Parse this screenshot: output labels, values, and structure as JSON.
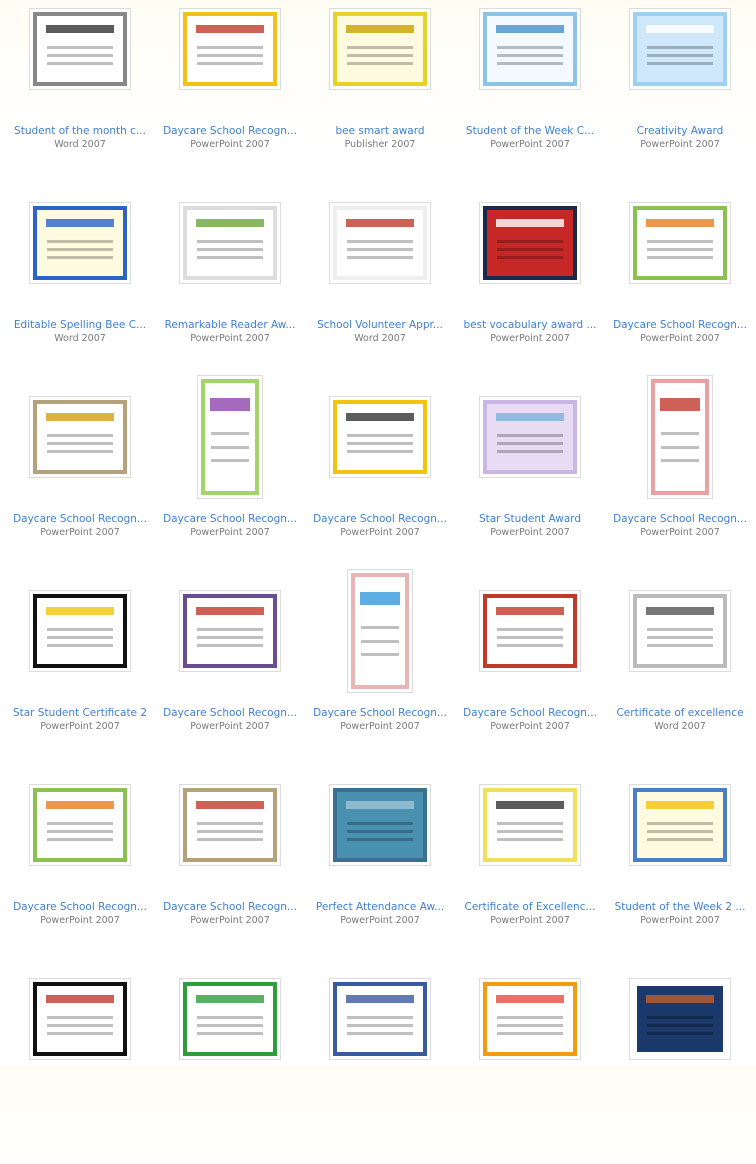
{
  "templates": [
    {
      "title": "Student of the month c...",
      "app": "Word 2007",
      "border": "#888888",
      "fill": "#ffffff",
      "accent": "#333333"
    },
    {
      "title": "Daycare School Recogn...",
      "app": "PowerPoint 2007",
      "border": "#f2c21b",
      "fill": "#ffffff",
      "accent": "#c0392b"
    },
    {
      "title": "bee smart award",
      "app": "Publisher 2007",
      "border": "#e6d22a",
      "fill": "#fffbe0",
      "accent": "#c9a200"
    },
    {
      "title": "Student of the Week C...",
      "app": "PowerPoint 2007",
      "border": "#8fc3e6",
      "fill": "#f2f9ff",
      "accent": "#4a90c8"
    },
    {
      "title": "Creativity Award",
      "app": "PowerPoint 2007",
      "border": "#9fd0f0",
      "fill": "#cfe8fb",
      "accent": "#ffffff"
    },
    {
      "title": "Editable Spelling Bee C...",
      "app": "Word 2007",
      "border": "#2b63c9",
      "fill": "#fffbe0",
      "accent": "#2b63c9"
    },
    {
      "title": "Remarkable Reader Aw...",
      "app": "PowerPoint 2007",
      "border": "#dddddd",
      "fill": "#ffffff",
      "accent": "#6aa83a"
    },
    {
      "title": "School Volunteer Appr...",
      "app": "Word 2007",
      "border": "#eeeeee",
      "fill": "#ffffff",
      "accent": "#c0392b"
    },
    {
      "title": "best vocabulary award ...",
      "app": "PowerPoint 2007",
      "border": "#1b2a4a",
      "fill": "#c62828",
      "accent": "#ffffff"
    },
    {
      "title": "Daycare School Recogn...",
      "app": "PowerPoint 2007",
      "border": "#8cc152",
      "fill": "#ffffff",
      "accent": "#e67e22"
    },
    {
      "title": "Daycare School Recogn...",
      "app": "PowerPoint 2007",
      "border": "#b5a27a",
      "fill": "#ffffff",
      "accent": "#d4a017"
    },
    {
      "title": "Daycare School Recogn...",
      "app": "PowerPoint 2007",
      "border": "#a5d46a",
      "fill": "#ffffff",
      "accent": "#8e44ad"
    },
    {
      "title": "Daycare School Recogn...",
      "app": "PowerPoint 2007",
      "border": "#f1c40f",
      "fill": "#ffffff",
      "accent": "#333333"
    },
    {
      "title": "Star Student Award",
      "app": "PowerPoint 2007",
      "border": "#c9b6e4",
      "fill": "#e8dcf5",
      "accent": "#7fb0d8"
    },
    {
      "title": "Daycare School Recogn...",
      "app": "PowerPoint 2007",
      "border": "#e8a0a0",
      "fill": "#ffffff",
      "accent": "#c0392b"
    },
    {
      "title": "Star Student Certificate 2",
      "app": "PowerPoint 2007",
      "border": "#111111",
      "fill": "#ffffff",
      "accent": "#f1c40f"
    },
    {
      "title": "Daycare School Recogn...",
      "app": "PowerPoint 2007",
      "border": "#6a4c93",
      "fill": "#ffffff",
      "accent": "#c0392b"
    },
    {
      "title": "Daycare School Recogn...",
      "app": "PowerPoint 2007",
      "border": "#e8b4b4",
      "fill": "#ffffff",
      "accent": "#3498db"
    },
    {
      "title": "Daycare School Recogn...",
      "app": "PowerPoint 2007",
      "border": "#c0392b",
      "fill": "#ffffff",
      "accent": "#c0392b"
    },
    {
      "title": "Certificate of excellence",
      "app": "Word 2007",
      "border": "#bbbbbb",
      "fill": "#ffffff",
      "accent": "#555555"
    },
    {
      "title": "Daycare School Recogn...",
      "app": "PowerPoint 2007",
      "border": "#8cc152",
      "fill": "#ffffff",
      "accent": "#e67e22"
    },
    {
      "title": "Daycare School Recogn...",
      "app": "PowerPoint 2007",
      "border": "#b5a27a",
      "fill": "#ffffff",
      "accent": "#c0392b"
    },
    {
      "title": "Perfect Attendance Aw...",
      "app": "PowerPoint 2007",
      "border": "#3b6f8f",
      "fill": "#4a90b0",
      "accent": "#9fc4d8"
    },
    {
      "title": "Certificate of Excellenc...",
      "app": "PowerPoint 2007",
      "border": "#f1e05a",
      "fill": "#ffffff",
      "accent": "#333333"
    },
    {
      "title": "Student of the Week 2 ...",
      "app": "PowerPoint 2007",
      "border": "#4a7fc8",
      "fill": "#fffbe0",
      "accent": "#f1c40f"
    },
    {
      "border": "#111111",
      "fill": "#ffffff",
      "accent": "#c0392b"
    },
    {
      "border": "#2e9e3a",
      "fill": "#ffffff",
      "accent": "#2e9e3a"
    },
    {
      "border": "#3b5ba0",
      "fill": "#ffffff",
      "accent": "#3b5ba0"
    },
    {
      "border": "#f39c12",
      "fill": "#ffffff",
      "accent": "#e74c3c"
    },
    {
      "border": "#ffffff",
      "fill": "#1b3a6b",
      "accent": "#c0602a"
    }
  ]
}
